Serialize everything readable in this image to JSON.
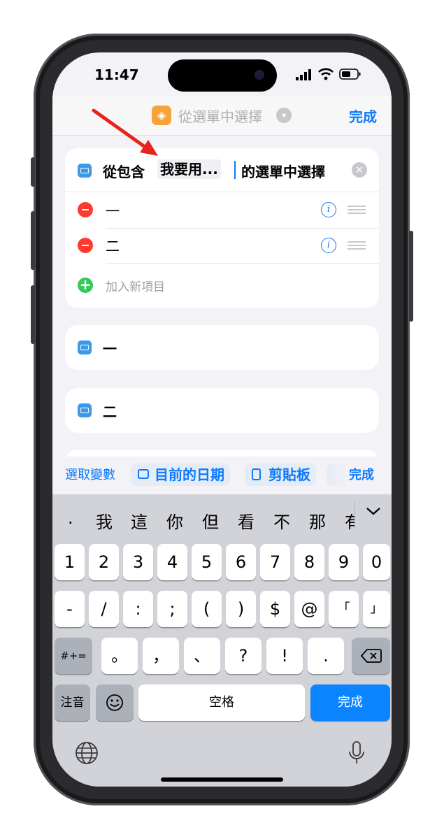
{
  "status_bar": {
    "time": "11:47"
  },
  "nav": {
    "title": "從選單中選擇",
    "done_label": "完成"
  },
  "choose_card": {
    "prefix": "從包含",
    "token": "我要用...",
    "suffix": "的選單中選擇",
    "items": [
      {
        "label": "一"
      },
      {
        "label": "二"
      }
    ],
    "add_placeholder": "加入新項目"
  },
  "case_blocks": [
    {
      "label": "一"
    },
    {
      "label": "二"
    }
  ],
  "accessory_bar": {
    "select_variable": "選取變數",
    "current_date": "目前的日期",
    "clipboard": "剪貼板",
    "done": "完成"
  },
  "keyboard": {
    "candidates": [
      ".",
      "我",
      "這",
      "你",
      "但",
      "看",
      "不",
      "那",
      "有"
    ],
    "row1": [
      "1",
      "2",
      "3",
      "4",
      "5",
      "6",
      "7",
      "8",
      "9",
      "0"
    ],
    "row2": [
      "-",
      "/",
      ":",
      ";",
      "(",
      ")",
      "$",
      "@",
      "「",
      "」"
    ],
    "row3": [
      "#+=",
      "。",
      "，",
      "、",
      "?",
      "!",
      "."
    ],
    "zhuyin": "注音",
    "space": "空格",
    "return": "完成"
  },
  "colors": {
    "accent": "#0a7aff",
    "delete": "#ff3b30",
    "add": "#34c759",
    "arrow": "#e8231c"
  }
}
